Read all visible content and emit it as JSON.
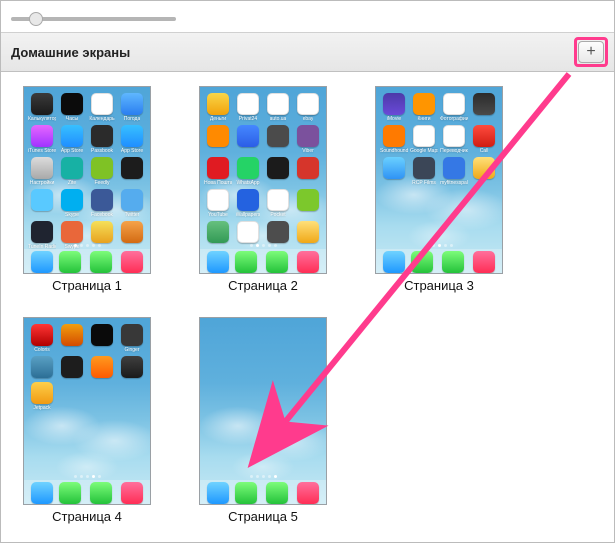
{
  "header": {
    "title": "Домашние экраны"
  },
  "add_button": {
    "glyph": "+"
  },
  "highlight_color": "#ff3b8d",
  "slider": {
    "min": 0,
    "max": 100,
    "value": 12
  },
  "dock": [
    {
      "label": "Mail",
      "color": "linear-gradient(#6fd2ff,#1e98ff)"
    },
    {
      "label": "Телефон",
      "color": "linear-gradient(#7dfc7a,#24c23a)"
    },
    {
      "label": "Сообщения",
      "color": "linear-gradient(#7dfc7a,#24c23a)"
    },
    {
      "label": "Музыка",
      "color": "linear-gradient(#ff6f9c,#ff2d55)"
    }
  ],
  "pages": [
    {
      "caption": "Страница 1",
      "apps": [
        {
          "label": "Калькулятор",
          "color": "linear-gradient(#3b3b3b,#1a1a1a)"
        },
        {
          "label": "Часы",
          "color": "#0b0b0b"
        },
        {
          "label": "Календарь",
          "color": "#ffffff"
        },
        {
          "label": "Погода",
          "color": "linear-gradient(#5fb7ff,#2a7ef0)"
        },
        {
          "label": "iTunes Store",
          "color": "linear-gradient(#e667ff,#a033ff)"
        },
        {
          "label": "App Store",
          "color": "linear-gradient(#38c0ff,#1f8eff)"
        },
        {
          "label": "Passbook",
          "color": "#2b2b2b"
        },
        {
          "label": "App Store",
          "color": "linear-gradient(#38c0ff,#1f8eff)"
        },
        {
          "label": "Настройки",
          "color": "linear-gradient(#dcdcdc,#a9a9a9)"
        },
        {
          "label": "Zite",
          "color": "#17b1a4"
        },
        {
          "label": "Feedly",
          "color": "#7fc225"
        },
        {
          "label": "",
          "color": "#1c1c1c"
        },
        {
          "label": "",
          "color": "#59c9ff"
        },
        {
          "label": "Skype",
          "color": "#00aff0"
        },
        {
          "label": "Facebook",
          "color": "#3b5998"
        },
        {
          "label": "Twitter",
          "color": "#55acee"
        },
        {
          "label": "TuneIn Radio",
          "color": "#1f2430"
        },
        {
          "label": "Swype",
          "color": "#e9673a"
        },
        {
          "label": "",
          "color": "linear-gradient(#f5e05a,#e8a21f)"
        },
        {
          "label": "",
          "color": "linear-gradient(#f5a34a,#d36a12)"
        }
      ]
    },
    {
      "caption": "Страница 2",
      "apps": [
        {
          "label": "Деньги",
          "color": "linear-gradient(#f9d648,#f2a20b)"
        },
        {
          "label": "Privat24",
          "color": "#ffffff"
        },
        {
          "label": "auto.ua",
          "color": "#ffffff"
        },
        {
          "label": "ebay",
          "color": "#ffffff"
        },
        {
          "label": "",
          "color": "#ff8a00"
        },
        {
          "label": "",
          "color": "linear-gradient(#4588ff,#2b5de6)"
        },
        {
          "label": "",
          "color": "#4b4b4b"
        },
        {
          "label": "Viber",
          "color": "#7b519d"
        },
        {
          "label": "Нова Пошта",
          "color": "#e01b22"
        },
        {
          "label": "WhatsApp",
          "color": "#25d366"
        },
        {
          "label": "",
          "color": "#1b1b1b"
        },
        {
          "label": "",
          "color": "#d6352b"
        },
        {
          "label": "YouTube",
          "color": "#ffffff"
        },
        {
          "label": "Wallpapers",
          "color": "#2462e0"
        },
        {
          "label": "Pocket",
          "color": "#ffffff"
        },
        {
          "label": "",
          "color": "#7cc82c"
        },
        {
          "label": "",
          "color": "linear-gradient(#66c07e,#329a55)"
        },
        {
          "label": "",
          "color": "#ffffff"
        },
        {
          "label": "",
          "color": "#4d4d4d"
        },
        {
          "label": "",
          "color": "linear-gradient(#ffe07a,#f0a818)"
        }
      ]
    },
    {
      "caption": "Страница 3",
      "apps": [
        {
          "label": "iMovie",
          "color": "linear-gradient(#4c3aa8,#6a49d8)"
        },
        {
          "label": "Книги",
          "color": "#ff9500"
        },
        {
          "label": "Фотографии",
          "color": "#ffffff"
        },
        {
          "label": "",
          "color": "linear-gradient(#2b2b2b,#4a4a4a)"
        },
        {
          "label": "Soundhound",
          "color": "#ff7a00"
        },
        {
          "label": "Google Maps",
          "color": "#ffffff"
        },
        {
          "label": "Переводчик",
          "color": "#ffffff"
        },
        {
          "label": "Call",
          "color": "linear-gradient(#ff4b3e,#d11c12)"
        },
        {
          "label": "",
          "color": "linear-gradient(#6ad0ff,#2f93f5)"
        },
        {
          "label": "RCP Films",
          "color": "#3b4657"
        },
        {
          "label": "myfitnesspal",
          "color": "#3578e5"
        },
        {
          "label": "",
          "color": "linear-gradient(#ffe07a,#f0a818)"
        }
      ]
    },
    {
      "caption": "Страница 4",
      "apps": [
        {
          "label": "Coloris",
          "color": "linear-gradient(#ff3535,#b00000)"
        },
        {
          "label": "",
          "color": "linear-gradient(#f29e0e,#d34b00)"
        },
        {
          "label": "",
          "color": "#0a0a0a"
        },
        {
          "label": "Ginger",
          "color": "#383838"
        },
        {
          "label": "",
          "color": "linear-gradient(#5aa0c4,#2c6f96)"
        },
        {
          "label": "",
          "color": "#1d1d1d"
        },
        {
          "label": "",
          "color": "linear-gradient(#ff9a1f,#ff5a00)"
        },
        {
          "label": "",
          "color": "linear-gradient(#3f3f3f,#1a1a1a)"
        },
        {
          "label": "Jetpack",
          "color": "linear-gradient(#fdcf4a,#f19a12)"
        }
      ]
    },
    {
      "caption": "Страница 5",
      "apps": []
    }
  ]
}
